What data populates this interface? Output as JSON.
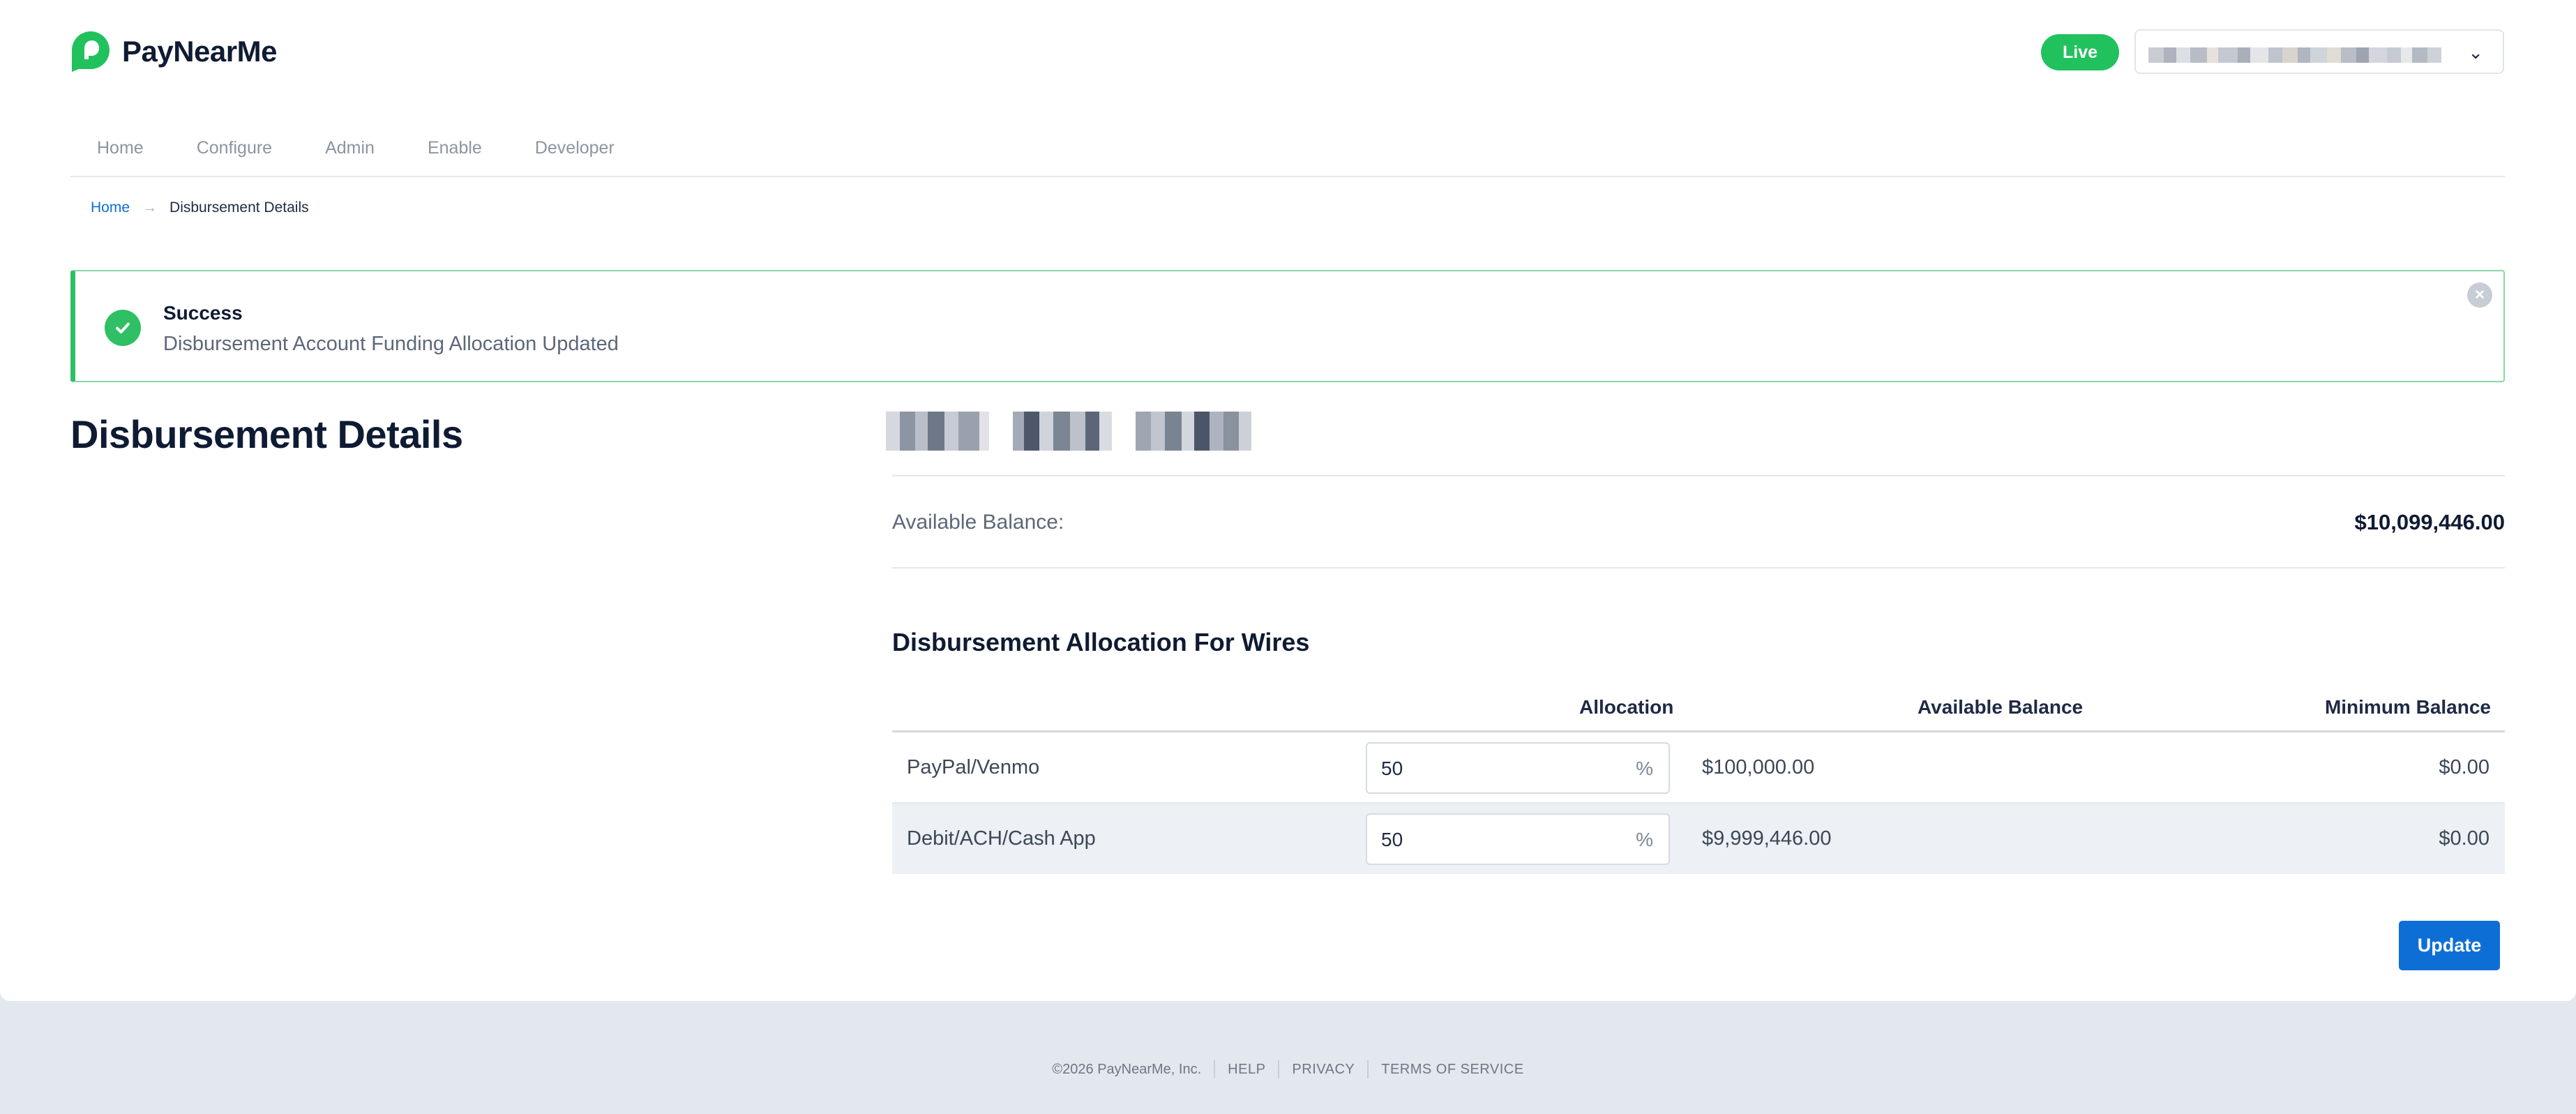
{
  "brand": {
    "name": "PayNearMe",
    "accent": "#21c25e",
    "logo_icon": "paynearme-logo-icon"
  },
  "header": {
    "environment_badge": "Live",
    "account_selector_icon": "chevron-down-icon"
  },
  "nav": {
    "items": [
      {
        "label": "Home"
      },
      {
        "label": "Configure"
      },
      {
        "label": "Admin"
      },
      {
        "label": "Enable"
      },
      {
        "label": "Developer"
      }
    ]
  },
  "breadcrumb": {
    "home": "Home",
    "separator": "→",
    "current": "Disbursement Details"
  },
  "alert": {
    "type": "success",
    "title": "Success",
    "message": "Disbursement Account Funding Allocation Updated",
    "icon": "check-circle-icon",
    "close_icon": "close-icon",
    "color": "#2fbf64"
  },
  "page": {
    "title": "Disbursement Details"
  },
  "balance": {
    "label": "Available Balance:",
    "value": "$10,099,446.00"
  },
  "allocation": {
    "section_title": "Disbursement Allocation For Wires",
    "columns": {
      "allocation": "Allocation",
      "available_balance": "Available Balance",
      "minimum_balance": "Minimum Balance"
    },
    "rows": [
      {
        "name": "PayPal/Venmo",
        "allocation": "50",
        "unit": "%",
        "available_balance": "$100,000.00",
        "minimum_balance": "$0.00"
      },
      {
        "name": "Debit/ACH/Cash App",
        "allocation": "50",
        "unit": "%",
        "available_balance": "$9,999,446.00",
        "minimum_balance": "$0.00"
      }
    ]
  },
  "actions": {
    "update_label": "Update",
    "primary_color": "#0d6fd6"
  },
  "footer": {
    "copyright": "©2026 PayNearMe, Inc.",
    "links": [
      "HELP",
      "PRIVACY",
      "TERMS OF SERVICE"
    ]
  }
}
